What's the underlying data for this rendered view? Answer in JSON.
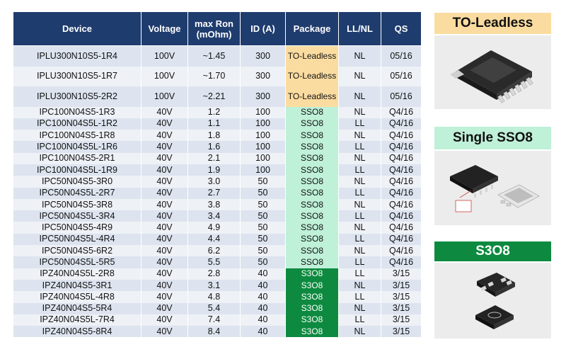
{
  "table": {
    "headers": [
      "Device",
      "Voltage",
      "max Ron\n(mOhm)",
      "ID (A)",
      "Package",
      "LL/NL",
      "QS"
    ],
    "header_lines": {
      "device": "Device",
      "voltage": "Voltage",
      "ron_line1": "max Ron",
      "ron_line2": "(mOhm)",
      "id": "ID (A)",
      "package": "Package",
      "llnl": "LL/NL",
      "qs": "QS"
    },
    "rows": [
      [
        "IPLU300N10S5-1R4",
        "100V",
        "~1.45",
        "300",
        "TO-Leadless",
        "NL",
        "05/16"
      ],
      [
        "IPLU300N10S5-1R7",
        "100V",
        "~1.70",
        "300",
        "TO-Leadless",
        "NL",
        "05/16"
      ],
      [
        "IPLU300N10S5-2R2",
        "100V",
        "~2.21",
        "300",
        "TO-Leadless",
        "NL",
        "05/16"
      ],
      [
        "IPC100N04S5-1R3",
        "40V",
        "1.2",
        "100",
        "SSO8",
        "NL",
        "Q4/16"
      ],
      [
        "IPC100N04S5L-1R2",
        "40V",
        "1.1",
        "100",
        "SSO8",
        "LL",
        "Q4/16"
      ],
      [
        "IPC100N04S5-1R8",
        "40V",
        "1.8",
        "100",
        "SSO8",
        "NL",
        "Q4/16"
      ],
      [
        "IPC100N04S5L-1R6",
        "40V",
        "1.6",
        "100",
        "SSO8",
        "LL",
        "Q4/16"
      ],
      [
        "IPC100N04S5-2R1",
        "40V",
        "2.1",
        "100",
        "SSO8",
        "NL",
        "Q4/16"
      ],
      [
        "IPC100N04S5L-1R9",
        "40V",
        "1.9",
        "100",
        "SSO8",
        "LL",
        "Q4/16"
      ],
      [
        "IPC50N04S5-3R0",
        "40V",
        "3.0",
        "50",
        "SSO8",
        "NL",
        "Q4/16"
      ],
      [
        "IPC50N04S5L-2R7",
        "40V",
        "2.7",
        "50",
        "SSO8",
        "LL",
        "Q4/16"
      ],
      [
        "IPC50N04S5-3R8",
        "40V",
        "3.8",
        "50",
        "SSO8",
        "NL",
        "Q4/16"
      ],
      [
        "IPC50N04S5L-3R4",
        "40V",
        "3.4",
        "50",
        "SSO8",
        "LL",
        "Q4/16"
      ],
      [
        "IPC50N04S5-4R9",
        "40V",
        "4.9",
        "50",
        "SSO8",
        "NL",
        "Q4/16"
      ],
      [
        "IPC50N04S5L-4R4",
        "40V",
        "4.4",
        "50",
        "SSO8",
        "LL",
        "Q4/16"
      ],
      [
        "IPC50N04S5-6R2",
        "40V",
        "6.2",
        "50",
        "SSO8",
        "NL",
        "Q4/16"
      ],
      [
        "IPC50N04S5L-5R5",
        "40V",
        "5.5",
        "50",
        "SSO8",
        "LL",
        "Q4/16"
      ],
      [
        "IPZ40N04S5L-2R8",
        "40V",
        "2.8",
        "40",
        "S3O8",
        "LL",
        "3/15"
      ],
      [
        "IPZ40N04S5-3R1",
        "40V",
        "3.1",
        "40",
        "S3O8",
        "NL",
        "3/15"
      ],
      [
        "IPZ40N04S5L-4R8",
        "40V",
        "4.8",
        "40",
        "S3O8",
        "LL",
        "3/15"
      ],
      [
        "IPZ40N04S5-5R4",
        "40V",
        "5.4",
        "40",
        "S3O8",
        "NL",
        "3/15"
      ],
      [
        "IPZ40N04S5L-7R4",
        "40V",
        "7.4",
        "40",
        "S3O8",
        "LL",
        "3/15"
      ],
      [
        "IPZ40N04S5-8R4",
        "40V",
        "8.4",
        "40",
        "S3O8",
        "NL",
        "3/15"
      ]
    ]
  },
  "panels": {
    "to_leadless": {
      "title": "TO-Leadless",
      "image": "to-leadless-package-photo"
    },
    "single_sso8": {
      "title": "Single SSO8",
      "image": "sso8-package-photo"
    },
    "s3o8": {
      "title": "S3O8",
      "image": "s3o8-package-photo"
    }
  },
  "colors": {
    "header_bg": "#1f3c6e",
    "row_odd": "#dde4ef",
    "row_even": "#eef1f6",
    "to_leadless": "#fbdca0",
    "sso8": "#bff0d8",
    "s3o8": "#0d8a3f"
  }
}
